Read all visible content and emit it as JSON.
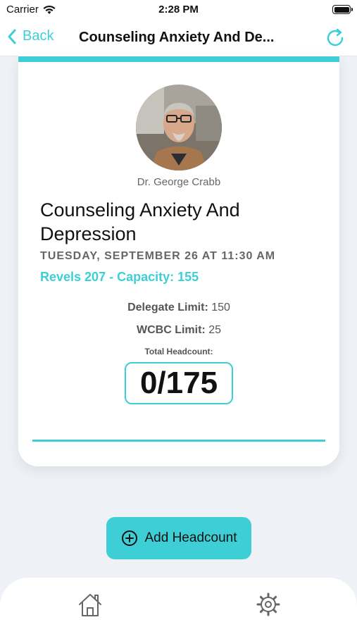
{
  "status_bar": {
    "carrier": "Carrier",
    "time": "2:28 PM"
  },
  "nav": {
    "back_label": "Back",
    "title": "Counseling Anxiety And De...",
    "back_icon": "chevron-left-icon",
    "refresh_icon": "refresh-icon"
  },
  "session": {
    "speaker_name": "Dr. George Crabb",
    "title": "Counseling Anxiety And Depression",
    "date": "TUESDAY, SEPTEMBER 26 AT 11:30 AM",
    "room": "Revels 207 - Capacity: 155",
    "delegate_limit_label": "Delegate Limit:",
    "delegate_limit_value": "150",
    "wcbc_limit_label": "WCBC Limit:",
    "wcbc_limit_value": "25",
    "headcount_label": "Total Headcount:",
    "headcount_value": "0/175"
  },
  "actions": {
    "add_headcount_label": "Add Headcount",
    "add_icon": "plus-circle-icon"
  },
  "tab_bar": {
    "home_icon": "home-icon",
    "settings_icon": "gear-icon"
  },
  "colors": {
    "accent": "#3ecfd6",
    "background": "#eef1f6"
  }
}
